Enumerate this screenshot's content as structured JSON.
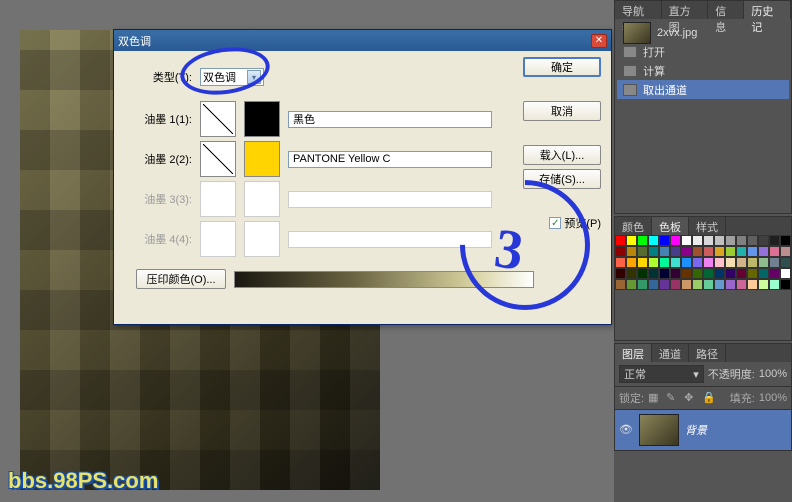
{
  "app": {
    "watermark": "bbs.98PS.com"
  },
  "dialog": {
    "title": "双色调",
    "type_label": "类型(T):",
    "type_value": "双色调",
    "ink1_label": "油墨 1(1):",
    "ink1_name": "黑色",
    "ink1_color": "#000000",
    "ink2_label": "油墨 2(2):",
    "ink2_name": "PANTONE Yellow C",
    "ink2_color": "#ffd400",
    "ink3_label": "油墨 3(3):",
    "ink4_label": "油墨 4(4):",
    "overprint_label": "压印颜色(O)...",
    "ok": "确定",
    "cancel": "取消",
    "load": "载入(L)...",
    "save": "存储(S)...",
    "preview": "预览(P)",
    "preview_checked": "✓"
  },
  "annotation3": "3",
  "nav_tabs": {
    "a": "导航器",
    "b": "直方图",
    "c": "信息",
    "d": "历史记"
  },
  "history": {
    "file": "2xvx.jpg",
    "items": [
      "打开",
      "计算",
      "取出通道"
    ]
  },
  "color_tabs": {
    "a": "颜色",
    "b": "色板",
    "c": "样式"
  },
  "layer_tabs": {
    "a": "图层",
    "b": "通道",
    "c": "路径"
  },
  "layers": {
    "mode": "正常",
    "opacity_label": "不透明度:",
    "opacity_val": "100%",
    "lock_label": "锁定:",
    "fill_label": "填充:",
    "fill_val": "100%",
    "bg_name": "背景"
  },
  "swatch_colors": [
    "#ff0000",
    "#ffff00",
    "#00ff00",
    "#00ffff",
    "#0000ff",
    "#ff00ff",
    "#ffffff",
    "#ececec",
    "#d8d8d8",
    "#c0c0c0",
    "#a0a0a0",
    "#808080",
    "#606060",
    "#404040",
    "#202020",
    "#000000",
    "#8b0000",
    "#b8860b",
    "#556b2f",
    "#008080",
    "#4682b4",
    "#483d8b",
    "#8b008b",
    "#a0522d",
    "#cd5c5c",
    "#daa520",
    "#9acd32",
    "#20b2aa",
    "#6495ed",
    "#9370db",
    "#db7093",
    "#bc8f8f",
    "#ff6347",
    "#ffa500",
    "#ffd700",
    "#adff2f",
    "#00fa9a",
    "#40e0d0",
    "#1e90ff",
    "#7b68ee",
    "#ee82ee",
    "#ffc0cb",
    "#f5deb3",
    "#d2b48c",
    "#bdb76b",
    "#8fbc8f",
    "#708090",
    "#2f4f4f",
    "#330000",
    "#333300",
    "#003300",
    "#003333",
    "#000033",
    "#330033",
    "#663300",
    "#336600",
    "#006633",
    "#003366",
    "#330066",
    "#660033",
    "#666600",
    "#006666",
    "#660066",
    "#ffffff",
    "#996633",
    "#669933",
    "#339966",
    "#336699",
    "#663399",
    "#993366",
    "#cc9966",
    "#99cc66",
    "#66cc99",
    "#6699cc",
    "#9966cc",
    "#cc6699",
    "#ffcc99",
    "#ccff99",
    "#99ffcc",
    "#000000"
  ]
}
